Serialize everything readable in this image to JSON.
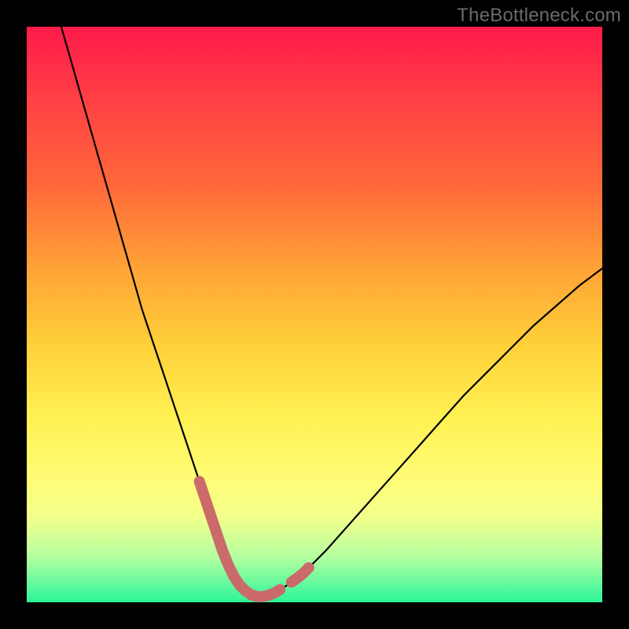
{
  "watermark": "TheBottleneck.com",
  "chart_data": {
    "type": "line",
    "title": "",
    "xlabel": "",
    "ylabel": "",
    "xlim": [
      0,
      100
    ],
    "ylim": [
      0,
      100
    ],
    "series": [
      {
        "name": "bottleneck-curve",
        "color": "#000000",
        "x": [
          6,
          8,
          10,
          12,
          14,
          16,
          18,
          20,
          22,
          24,
          26,
          28,
          30,
          32,
          33,
          34,
          35,
          36,
          37,
          38,
          39,
          40,
          41,
          42,
          43,
          45,
          48,
          52,
          56,
          60,
          64,
          68,
          72,
          76,
          80,
          84,
          88,
          92,
          96,
          100
        ],
        "y": [
          100,
          93,
          86,
          79,
          72,
          65,
          58,
          51,
          45,
          39,
          33,
          27,
          21,
          15,
          12,
          9,
          6.5,
          4.5,
          3,
          2,
          1.3,
          1,
          1,
          1.2,
          1.6,
          2.8,
          5,
          9,
          13.5,
          18,
          22.5,
          27,
          31.5,
          36,
          40,
          44,
          48,
          51.5,
          55,
          58
        ]
      }
    ],
    "highlight_segments": [
      {
        "name": "left-dip",
        "color": "#cb6a6a",
        "x": [
          30,
          31,
          32,
          33,
          34,
          35,
          36,
          37
        ],
        "y": [
          21,
          18,
          15,
          12,
          9,
          6.5,
          4.5,
          3
        ]
      },
      {
        "name": "trough",
        "color": "#cb6a6a",
        "x": [
          37,
          38,
          39,
          40,
          41,
          42,
          43,
          44
        ],
        "y": [
          3,
          2,
          1.3,
          1,
          1,
          1.2,
          1.6,
          2.2
        ]
      },
      {
        "name": "right-bump",
        "color": "#cb6a6a",
        "x": [
          46,
          47,
          48,
          49
        ],
        "y": [
          3.5,
          4.2,
          5,
          6
        ]
      }
    ],
    "gradient_stops": [
      {
        "pos": 0,
        "color": "#ff1a4b"
      },
      {
        "pos": 12,
        "color": "#ff3e45"
      },
      {
        "pos": 28,
        "color": "#ff6a3a"
      },
      {
        "pos": 42,
        "color": "#ffa336"
      },
      {
        "pos": 56,
        "color": "#ffd23a"
      },
      {
        "pos": 68,
        "color": "#fff153"
      },
      {
        "pos": 78,
        "color": "#fffc74"
      },
      {
        "pos": 85,
        "color": "#f3ff8a"
      },
      {
        "pos": 92,
        "color": "#b6ffa0"
      },
      {
        "pos": 100,
        "color": "#2cf59a"
      }
    ]
  }
}
